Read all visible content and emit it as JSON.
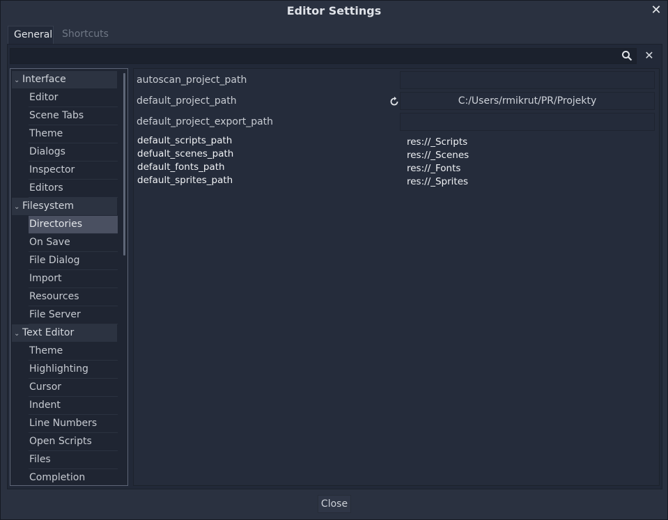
{
  "window": {
    "title": "Editor Settings"
  },
  "tabs": [
    {
      "label": "General",
      "active": true
    },
    {
      "label": "Shortcuts",
      "active": false
    }
  ],
  "search": {
    "value": "",
    "placeholder": ""
  },
  "tree": [
    {
      "label": "Interface",
      "kind": "section"
    },
    {
      "label": "Editor",
      "kind": "item"
    },
    {
      "label": "Scene Tabs",
      "kind": "item"
    },
    {
      "label": "Theme",
      "kind": "item"
    },
    {
      "label": "Dialogs",
      "kind": "item"
    },
    {
      "label": "Inspector",
      "kind": "item"
    },
    {
      "label": "Editors",
      "kind": "item"
    },
    {
      "label": "Filesystem",
      "kind": "section"
    },
    {
      "label": "Directories",
      "kind": "item",
      "selected": true
    },
    {
      "label": "On Save",
      "kind": "item"
    },
    {
      "label": "File Dialog",
      "kind": "item"
    },
    {
      "label": "Import",
      "kind": "item"
    },
    {
      "label": "Resources",
      "kind": "item"
    },
    {
      "label": "File Server",
      "kind": "item"
    },
    {
      "label": "Text Editor",
      "kind": "section"
    },
    {
      "label": "Theme",
      "kind": "item"
    },
    {
      "label": "Highlighting",
      "kind": "item"
    },
    {
      "label": "Cursor",
      "kind": "item"
    },
    {
      "label": "Indent",
      "kind": "item"
    },
    {
      "label": "Line Numbers",
      "kind": "item"
    },
    {
      "label": "Open Scripts",
      "kind": "item"
    },
    {
      "label": "Files",
      "kind": "item"
    },
    {
      "label": "Completion",
      "kind": "item"
    }
  ],
  "properties": [
    {
      "name": "autoscan_project_path",
      "value": ""
    },
    {
      "name": "default_project_path",
      "value": "C:/Users/rmikrut/PR/Projekty"
    },
    {
      "name": "default_project_export_path",
      "value": ""
    }
  ],
  "custom_properties": [
    {
      "name": "default_scripts_path",
      "value": "res://_Scripts"
    },
    {
      "name": "defualt_scenes_path",
      "value": "res://_Scenes"
    },
    {
      "name": "default_fonts_path",
      "value": "res://_Fonts"
    },
    {
      "name": "default_sprites_path",
      "value": "res://_Sprites"
    }
  ],
  "footer": {
    "close_label": "Close"
  },
  "colors": {
    "background": "#2a3140",
    "panel": "#222938",
    "selected": "#4a5061"
  }
}
